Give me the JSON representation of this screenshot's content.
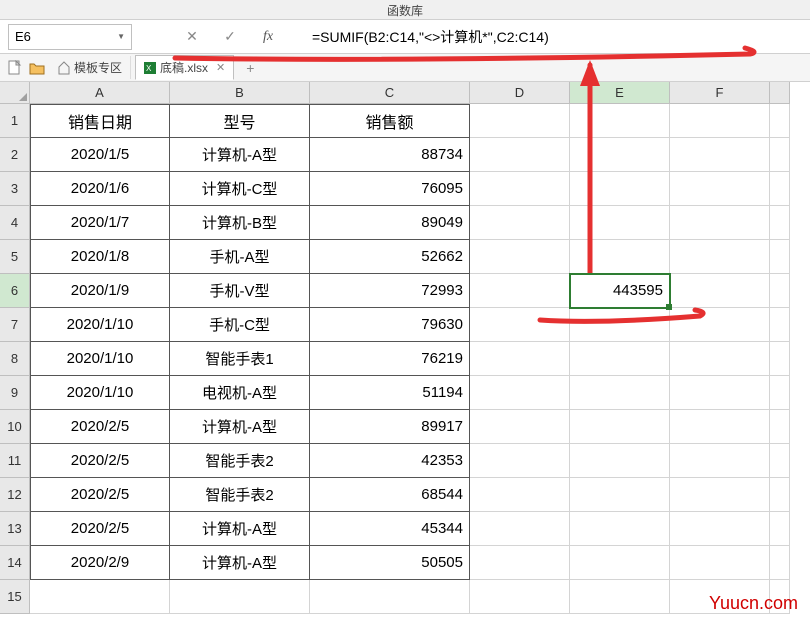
{
  "ribbon_title": "函数库",
  "name_box": {
    "value": "E6"
  },
  "formula_bar": {
    "value": "=SUMIF(B2:C14,\"<>计算机*\",C2:C14)"
  },
  "tabs": {
    "template": "模板专区",
    "file": "底稿.xlsx"
  },
  "columns": [
    "A",
    "B",
    "C",
    "D",
    "E",
    "F"
  ],
  "row_numbers": [
    "1",
    "2",
    "3",
    "4",
    "5",
    "6",
    "7",
    "8",
    "9",
    "10",
    "11",
    "12",
    "13",
    "14",
    "15"
  ],
  "headers": {
    "a": "销售日期",
    "b": "型号",
    "c": "销售额"
  },
  "chart_data": {
    "type": "table",
    "columns": [
      "销售日期",
      "型号",
      "销售额"
    ],
    "rows": [
      [
        "2020/1/5",
        "计算机-A型",
        88734
      ],
      [
        "2020/1/6",
        "计算机-C型",
        76095
      ],
      [
        "2020/1/7",
        "计算机-B型",
        89049
      ],
      [
        "2020/1/8",
        "手机-A型",
        52662
      ],
      [
        "2020/1/9",
        "手机-V型",
        72993
      ],
      [
        "2020/1/10",
        "手机-C型",
        79630
      ],
      [
        "2020/1/10",
        "智能手表1",
        76219
      ],
      [
        "2020/1/10",
        "电视机-A型",
        51194
      ],
      [
        "2020/2/5",
        "计算机-A型",
        89917
      ],
      [
        "2020/2/5",
        "智能手表2",
        42353
      ],
      [
        "2020/2/5",
        "智能手表2",
        68544
      ],
      [
        "2020/2/5",
        "计算机-A型",
        45344
      ],
      [
        "2020/2/9",
        "计算机-A型",
        50505
      ]
    ]
  },
  "result_cell": {
    "value": "443595"
  },
  "watermark": "Yuucn.com"
}
